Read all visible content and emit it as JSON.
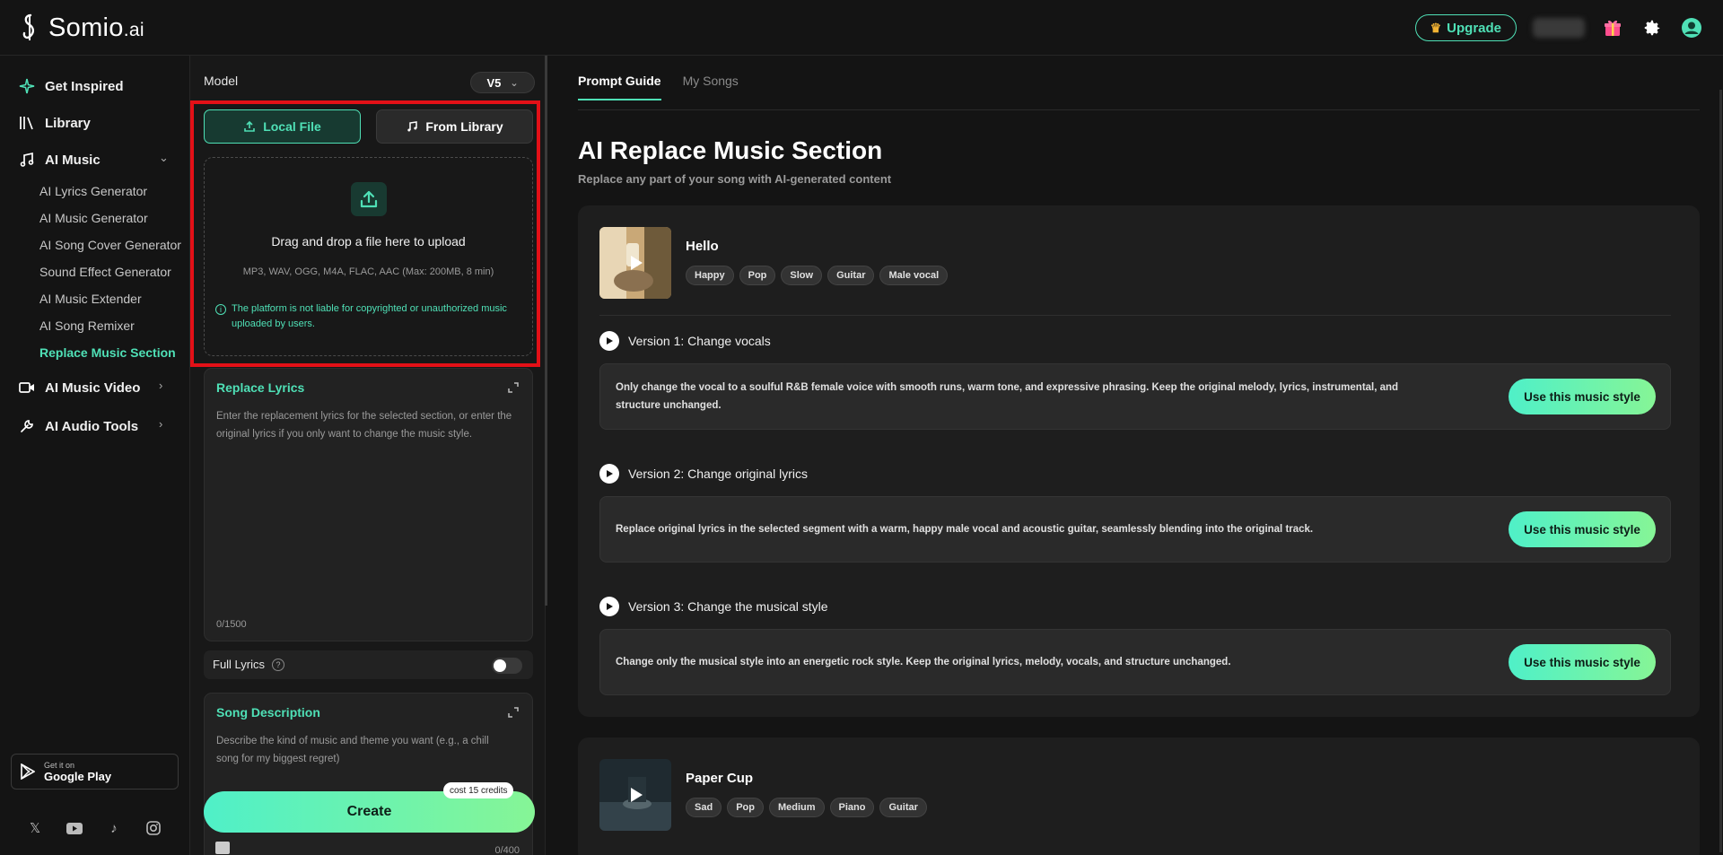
{
  "app": {
    "brand_name": "Somio",
    "brand_suffix": ".ai",
    "accent": "#4fe0b6",
    "highlight": "#e31017"
  },
  "topbar": {
    "upgrade_label": "Upgrade",
    "user_name": "Nast",
    "icons": [
      "gift-icon",
      "gear-icon",
      "avatar"
    ]
  },
  "sidebar": {
    "items": [
      {
        "label": "Get Inspired",
        "icon": "sparkle-icon"
      },
      {
        "label": "Library",
        "icon": "library-icon"
      },
      {
        "label": "AI Music",
        "icon": "music-note-icon",
        "expanded": true
      },
      {
        "label": "AI Music Video",
        "icon": "video-icon"
      },
      {
        "label": "AI Audio Tools",
        "icon": "wrench-icon"
      }
    ],
    "subitems": [
      {
        "label": "AI Lyrics Generator"
      },
      {
        "label": "AI Music Generator"
      },
      {
        "label": "AI Song Cover Generator"
      },
      {
        "label": "Sound Effect Generator"
      },
      {
        "label": "AI Music Extender"
      },
      {
        "label": "AI Song Remixer"
      },
      {
        "label": "Replace Music Section",
        "active": true
      }
    ],
    "store": {
      "small": "Get it on",
      "big": "Google Play"
    },
    "socials": [
      "x-icon",
      "youtube-icon",
      "tiktok-icon",
      "instagram-icon"
    ]
  },
  "panel": {
    "model_label": "Model",
    "model_value": "V5",
    "tab_local": "Local File",
    "tab_library": "From Library",
    "drop_title": "Drag and drop a file here to upload",
    "drop_formats": "MP3, WAV, OGG, M4A, FLAC, AAC (Max: 200MB, 8 min)",
    "drop_notice": "The platform is not liable for copyrighted or unauthorized music uploaded by users.",
    "lyrics_title": "Replace Lyrics",
    "lyrics_placeholder": "Enter the replacement lyrics for the selected section, or enter the original lyrics if you only want to change the music style.",
    "lyrics_counter": "0/1500",
    "full_lyrics_label": "Full Lyrics",
    "full_lyrics_on": false,
    "desc_title": "Song Description",
    "desc_placeholder": "Describe the kind of music and theme you want (e.g., a chill song for my biggest regret)",
    "desc_counter": "0/400",
    "create_label": "Create",
    "cost_label": "cost 15 credits"
  },
  "main": {
    "tabs": [
      {
        "label": "Prompt Guide",
        "active": true
      },
      {
        "label": "My Songs",
        "active": false
      }
    ],
    "title": "AI Replace Music Section",
    "subtitle": "Replace any part of your song with AI-generated content",
    "songs": [
      {
        "name": "Hello",
        "tags": [
          "Happy",
          "Pop",
          "Slow",
          "Guitar",
          "Male vocal"
        ],
        "versions": [
          {
            "title": "Version 1: Change vocals",
            "prompt": "Only change the vocal to a soulful R&B female voice with smooth runs, warm tone, and expressive phrasing. Keep the original melody, lyrics, instrumental, and structure unchanged.",
            "button": "Use this music style"
          },
          {
            "title": "Version 2: Change original lyrics",
            "prompt": "Replace original lyrics in the selected segment with a warm, happy male vocal and acoustic guitar, seamlessly blending into the original track.",
            "button": "Use this music style"
          },
          {
            "title": "Version 3: Change the musical style",
            "prompt": "Change only the musical style into an energetic rock style. Keep the original lyrics, melody, vocals, and structure unchanged.",
            "button": "Use this music style"
          }
        ]
      },
      {
        "name": "Paper Cup",
        "tags": [
          "Sad",
          "Pop",
          "Medium",
          "Piano",
          "Guitar"
        ]
      }
    ]
  }
}
